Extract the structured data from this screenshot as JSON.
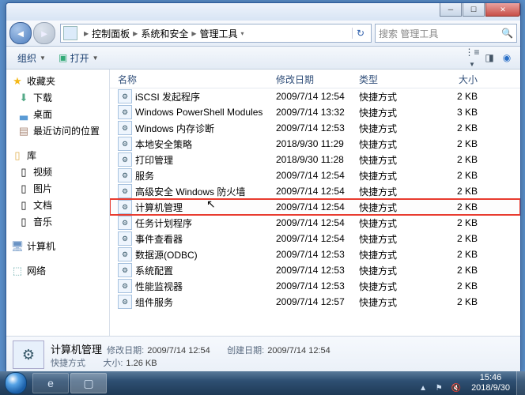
{
  "breadcrumbs": [
    "控制面板",
    "系统和安全",
    "管理工具"
  ],
  "search": {
    "placeholder": "搜索 管理工具"
  },
  "toolbar": {
    "organize": "组织",
    "open": "打开"
  },
  "side": {
    "favorites": "收藏夹",
    "downloads": "下载",
    "desktop": "桌面",
    "recent": "最近访问的位置",
    "libraries": "库",
    "videos": "视频",
    "pictures": "图片",
    "documents": "文档",
    "music": "音乐",
    "computer": "计算机",
    "network": "网络"
  },
  "columns": {
    "name": "名称",
    "date": "修改日期",
    "type": "类型",
    "size": "大小"
  },
  "rows": [
    {
      "name": "iSCSI 发起程序",
      "date": "2009/7/14 12:54",
      "type": "快捷方式",
      "size": "2 KB"
    },
    {
      "name": "Windows PowerShell Modules",
      "date": "2009/7/14 13:32",
      "type": "快捷方式",
      "size": "3 KB"
    },
    {
      "name": "Windows 内存诊断",
      "date": "2009/7/14 12:53",
      "type": "快捷方式",
      "size": "2 KB"
    },
    {
      "name": "本地安全策略",
      "date": "2018/9/30 11:29",
      "type": "快捷方式",
      "size": "2 KB"
    },
    {
      "name": "打印管理",
      "date": "2018/9/30 11:28",
      "type": "快捷方式",
      "size": "2 KB"
    },
    {
      "name": "服务",
      "date": "2009/7/14 12:54",
      "type": "快捷方式",
      "size": "2 KB"
    },
    {
      "name": "高级安全 Windows 防火墙",
      "date": "2009/7/14 12:54",
      "type": "快捷方式",
      "size": "2 KB"
    },
    {
      "name": "计算机管理",
      "date": "2009/7/14 12:54",
      "type": "快捷方式",
      "size": "2 KB",
      "highlight": true
    },
    {
      "name": "任务计划程序",
      "date": "2009/7/14 12:54",
      "type": "快捷方式",
      "size": "2 KB"
    },
    {
      "name": "事件查看器",
      "date": "2009/7/14 12:54",
      "type": "快捷方式",
      "size": "2 KB"
    },
    {
      "name": "数据源(ODBC)",
      "date": "2009/7/14 12:53",
      "type": "快捷方式",
      "size": "2 KB"
    },
    {
      "name": "系统配置",
      "date": "2009/7/14 12:53",
      "type": "快捷方式",
      "size": "2 KB"
    },
    {
      "name": "性能监视器",
      "date": "2009/7/14 12:53",
      "type": "快捷方式",
      "size": "2 KB"
    },
    {
      "name": "组件服务",
      "date": "2009/7/14 12:57",
      "type": "快捷方式",
      "size": "2 KB"
    }
  ],
  "details": {
    "name": "计算机管理",
    "modLabel": "修改日期:",
    "mod": "2009/7/14 12:54",
    "createdLabel": "创建日期:",
    "created": "2009/7/14 12:54",
    "typeLabel": "快捷方式",
    "sizeLabel": "大小:",
    "size": "1.26 KB"
  },
  "clock": {
    "time": "15:46",
    "date": "2018/9/30"
  }
}
